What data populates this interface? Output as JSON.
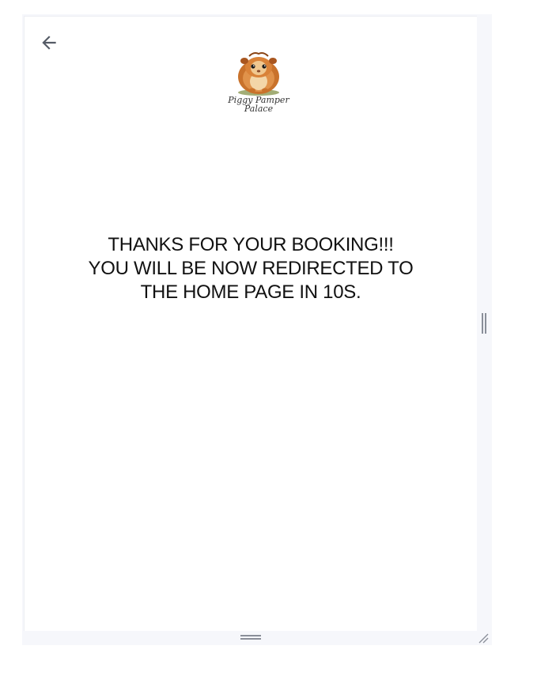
{
  "header": {
    "back_icon": "arrow-left-icon",
    "logo": {
      "caption_line1": "Piggy Pamper",
      "caption_line2": "Palace"
    }
  },
  "main": {
    "message_lines": [
      "THANKS FOR YOUR BOOKING!!!",
      "YOU WILL BE NOW REDIRECTED TO",
      "THE HOME PAGE IN 10S."
    ]
  },
  "colors": {
    "text": "#111111",
    "icon": "#555b66",
    "frame": "#f6f7fb"
  }
}
